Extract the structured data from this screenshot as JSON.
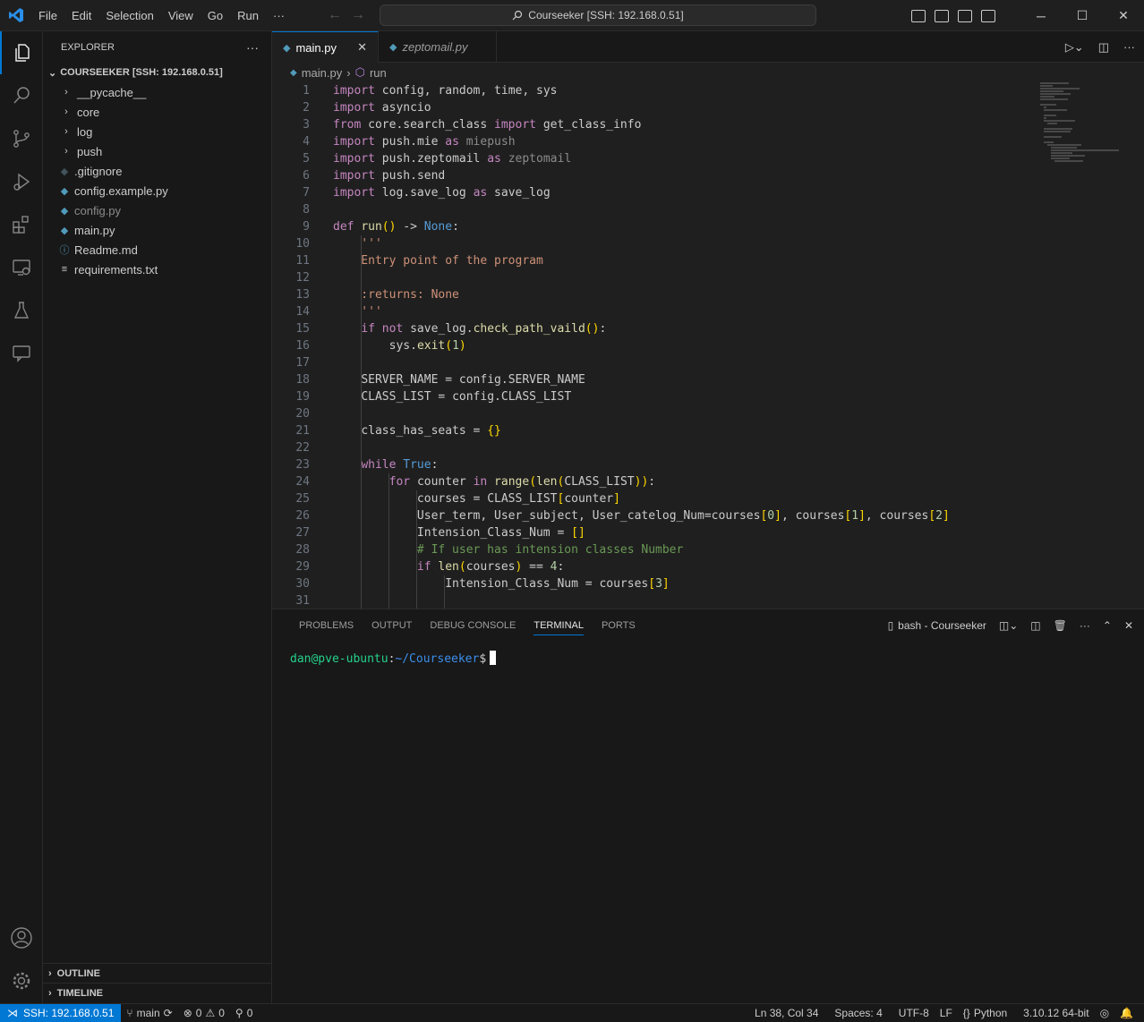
{
  "menu": [
    "File",
    "Edit",
    "Selection",
    "View",
    "Go",
    "Run",
    "···"
  ],
  "command_center": "Courseeker [SSH: 192.168.0.51]",
  "sidebar": {
    "title": "EXPLORER",
    "folder": "COURSEEKER [SSH: 192.168.0.51]",
    "items": [
      {
        "label": "__pycache__",
        "type": "folder"
      },
      {
        "label": "core",
        "type": "folder"
      },
      {
        "label": "log",
        "type": "folder"
      },
      {
        "label": "push",
        "type": "folder"
      },
      {
        "label": ".gitignore",
        "type": "gitignore"
      },
      {
        "label": "config.example.py",
        "type": "py"
      },
      {
        "label": "config.py",
        "type": "py-dim"
      },
      {
        "label": "main.py",
        "type": "py"
      },
      {
        "label": "Readme.md",
        "type": "info"
      },
      {
        "label": "requirements.txt",
        "type": "txt"
      }
    ],
    "outline": "OUTLINE",
    "timeline": "TIMELINE"
  },
  "tabs": [
    {
      "label": "main.py",
      "active": true
    },
    {
      "label": "zeptomail.py",
      "active": false
    }
  ],
  "breadcrumb": {
    "file": "main.py",
    "symbol": "run"
  },
  "code_lines": [
    "import config, random, time, sys",
    "import asyncio",
    "from core.search_class import get_class_info",
    "import push.mie as miepush",
    "import push.zeptomail as zeptomail",
    "import push.send",
    "import log.save_log as save_log",
    "",
    "def run() -> None:",
    "    '''",
    "    Entry point of the program",
    "",
    "    :returns: None",
    "    '''",
    "    if not save_log.check_path_vaild():",
    "        sys.exit(1)",
    "",
    "    SERVER_NAME = config.SERVER_NAME",
    "    CLASS_LIST = config.CLASS_LIST",
    "",
    "    class_has_seats = {}",
    "",
    "    while True:",
    "        for counter in range(len(CLASS_LIST)):",
    "            courses = CLASS_LIST[counter]",
    "            User_term, User_subject, User_catelog_Num=courses[0], courses[1], courses[2]",
    "            Intension_Class_Num = []",
    "            # If user has intension classes Number",
    "            if len(courses) == 4:",
    "                Intension_Class_Num = courses[3]",
    ""
  ],
  "panel": {
    "tabs": [
      "PROBLEMS",
      "OUTPUT",
      "DEBUG CONSOLE",
      "TERMINAL",
      "PORTS"
    ],
    "active_tab": "TERMINAL",
    "terminal_name": "bash - Courseeker",
    "prompt_user": "dan@pve-ubuntu",
    "prompt_path": "~/Courseeker",
    "prompt_symbol": "$"
  },
  "status": {
    "remote": "SSH: 192.168.0.51",
    "branch": "main",
    "errors": "0",
    "warnings": "0",
    "ports": "0",
    "position": "Ln 38, Col 34",
    "spaces": "Spaces: 4",
    "encoding": "UTF-8",
    "eol": "LF",
    "language": "Python",
    "interpreter": "3.10.12 64-bit"
  },
  "colors": {
    "accent": "#0078d4",
    "keyword": "#c586c0",
    "function": "#dcdcaa",
    "string": "#ce9178",
    "comment": "#6a9955"
  }
}
